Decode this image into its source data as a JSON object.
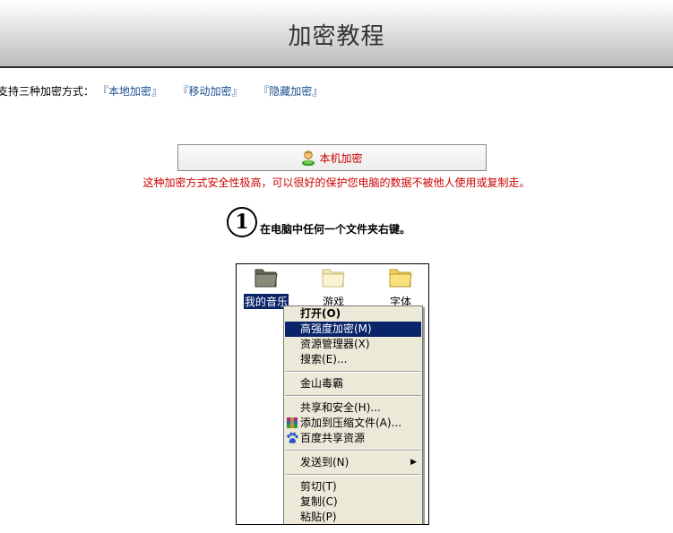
{
  "header": {
    "title": "加密教程"
  },
  "methods": {
    "intro": "支持三种加密方式：",
    "links": [
      "『本地加密』",
      "『移动加密』",
      "『隐藏加密』"
    ]
  },
  "local_box": {
    "icon": "user-icon",
    "label": "本机加密",
    "description": "这种加密方式安全性极高，可以很好的保护您电脑的数据不被他人使用或复制走。"
  },
  "step": {
    "number": "①",
    "text": "在电脑中任何一个文件夹右键。"
  },
  "screenshot": {
    "folders": [
      {
        "label": "我的音乐",
        "selected": true,
        "icon": "music-folder-icon"
      },
      {
        "label": "游戏",
        "selected": false,
        "icon": "folder-icon"
      },
      {
        "label": "字体",
        "selected": false,
        "icon": "folder-icon"
      }
    ],
    "menu": [
      {
        "label": "打开(O)",
        "bold": true
      },
      {
        "label": "高强度加密(M)",
        "highlighted": true
      },
      {
        "label": "资源管理器(X)"
      },
      {
        "label": "搜索(E)..."
      },
      {
        "separator": true
      },
      {
        "label": "金山毒霸"
      },
      {
        "separator": true
      },
      {
        "label": "共享和安全(H)..."
      },
      {
        "label": "添加到压缩文件(A)...",
        "icon": "winrar-icon"
      },
      {
        "label": "百度共享资源",
        "icon": "baidu-paw-icon"
      },
      {
        "separator": true
      },
      {
        "label": "发送到(N)",
        "submenu": true
      },
      {
        "separator": true
      },
      {
        "label": "剪切(T)"
      },
      {
        "label": "复制(C)"
      },
      {
        "label": "粘贴(P)"
      }
    ],
    "colors": {
      "highlight": "#0a246a",
      "menu_bg": "#ece9d8",
      "accent_red": "#cc0000"
    }
  }
}
